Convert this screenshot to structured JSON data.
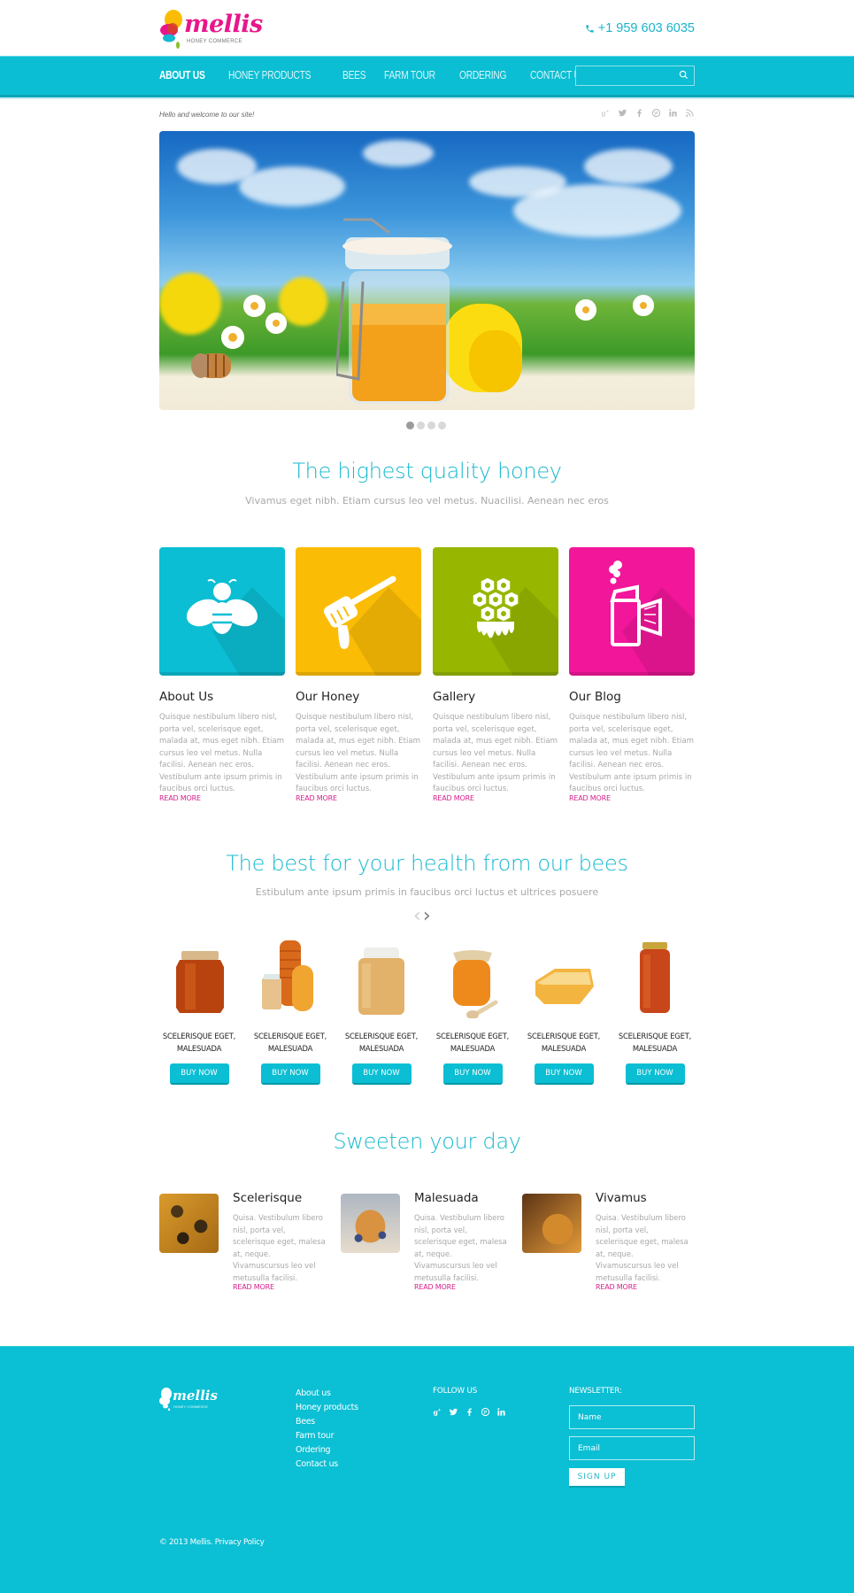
{
  "header": {
    "logo_text": "mellis",
    "logo_tagline": "HONEY COMMERCE",
    "phone": "+1 959 603 6035",
    "phone_icon": "phone-icon"
  },
  "nav": {
    "items": [
      {
        "label": "ABOUT US",
        "active": true
      },
      {
        "label": "HONEY PRODUCTS",
        "active": false
      },
      {
        "label": "BEES",
        "active": false
      },
      {
        "label": "FARM TOUR",
        "active": false
      },
      {
        "label": "ORDERING",
        "active": false
      },
      {
        "label": "CONTACT US",
        "active": false
      }
    ],
    "search": {
      "value": "",
      "placeholder": "",
      "icon": "search-icon"
    }
  },
  "topbar": {
    "welcome": "Hello and welcome to our site!",
    "social": [
      {
        "name": "google-plus-icon",
        "glyph": "g+"
      },
      {
        "name": "twitter-icon",
        "glyph": "t"
      },
      {
        "name": "facebook-icon",
        "glyph": "f"
      },
      {
        "name": "pinterest-icon",
        "glyph": "p"
      },
      {
        "name": "linkedin-icon",
        "glyph": "in"
      },
      {
        "name": "rss-icon",
        "glyph": "rss"
      }
    ]
  },
  "slider": {
    "image_alt": "Honey jar in a flower meadow",
    "slides_total": 4,
    "active_slide": 1
  },
  "section1": {
    "title": "The highest quality honey",
    "subtitle": "Vivamus eget nibh. Etiam cursus leo vel metus. Nuacilisi. Aenean nec eros"
  },
  "features": [
    {
      "title": "About Us",
      "icon": "bee-icon",
      "color": "#0bbed3",
      "text": "Quisque nestibulum libero nisl, porta vel, scelerisque eget, malada at, mus eget nibh. Etiam cursus leo vel metus. Nulla facilisi. Aenean nec eros. Vestibulum ante ipsum primis in faucibus orci luctus.",
      "link": "READ MORE"
    },
    {
      "title": "Our Honey",
      "icon": "honey-dipper-icon",
      "color": "#fbbc05",
      "text": "Quisque nestibulum libero nisl, porta vel, scelerisque eget, malada at, mus eget nibh. Etiam cursus leo vel metus. Nulla facilisi. Aenean nec eros. Vestibulum ante ipsum primis in faucibus orci luctus.",
      "link": "READ MORE"
    },
    {
      "title": "Gallery",
      "icon": "honeycomb-icon",
      "color": "#96b600",
      "text": "Quisque nestibulum libero nisl, porta vel, scelerisque eget, malada at, mus eget nibh. Etiam cursus leo vel metus. Nulla facilisi. Aenean nec eros. Vestibulum ante ipsum primis in faucibus orci luctus.",
      "link": "READ MORE"
    },
    {
      "title": "Our Blog",
      "icon": "bee-smoker-icon",
      "color": "#f2169a",
      "text": "Quisque nestibulum libero nisl, porta vel, scelerisque eget, malada at, mus eget nibh. Etiam cursus leo vel metus. Nulla facilisi. Aenean nec eros. Vestibulum ante ipsum primis in faucibus orci luctus.",
      "link": "READ MORE"
    }
  ],
  "section2": {
    "title": "The best for your health from our bees",
    "subtitle": "Estibulum ante ipsum primis in faucibus orci luctus et ultrices posuere",
    "prev_icon": "chevron-left-icon",
    "next_icon": "chevron-right-icon"
  },
  "products": [
    {
      "name_line1": "SCELERISQUE EGET,",
      "name_line2": "MALESUADA",
      "button": "BUY NOW",
      "image": "honey-jar-hexagonal"
    },
    {
      "name_line1": "SCELERISQUE EGET,",
      "name_line2": "MALESUADA",
      "button": "BUY NOW",
      "image": "honey-jars-group"
    },
    {
      "name_line1": "SCELERISQUE EGET,",
      "name_line2": "MALESUADA",
      "button": "BUY NOW",
      "image": "creamed-honey-jar"
    },
    {
      "name_line1": "SCELERISQUE EGET,",
      "name_line2": "MALESUADA",
      "button": "BUY NOW",
      "image": "honey-jar-with-dipper"
    },
    {
      "name_line1": "SCELERISQUE EGET,",
      "name_line2": "MALESUADA",
      "button": "BUY NOW",
      "image": "honeycomb-piece"
    },
    {
      "name_line1": "SCELERISQUE EGET,",
      "name_line2": "MALESUADA",
      "button": "BUY NOW",
      "image": "tall-honey-jar"
    }
  ],
  "section3": {
    "title": "Sweeten your day"
  },
  "blog": [
    {
      "title": "Scelerisque",
      "image": "bees-on-honeycomb",
      "text": "Quisa. Vestibulum libero nisl, porta vel, scelerisque eget, malesa at, neque. Vivamuscursus leo vel metusulla facilisi.",
      "link": "READ MORE"
    },
    {
      "title": "Malesuada",
      "image": "pancakes-with-honey",
      "text": "Quisa. Vestibulum libero nisl, porta vel, scelerisque eget, malesa at, neque. Vivamuscursus leo vel metusulla facilisi.",
      "link": "READ MORE"
    },
    {
      "title": "Vivamus",
      "image": "honey-dipper-pour",
      "text": "Quisa. Vestibulum libero nisl, porta vel, scelerisque eget, malesa at, neque. Vivamuscursus leo vel metusulla facilisi.",
      "link": "READ MORE"
    }
  ],
  "footer": {
    "logo_text": "mellis",
    "logo_tagline": "HONEY COMMERCE",
    "links": [
      "About us",
      "Honey products",
      "Bees",
      "Farm tour",
      "Ordering",
      "Contact us"
    ],
    "follow_title": "FOLLOW US",
    "follow_icons": [
      {
        "name": "google-plus-icon",
        "glyph": "g+"
      },
      {
        "name": "twitter-icon",
        "glyph": "t"
      },
      {
        "name": "facebook-icon",
        "glyph": "f"
      },
      {
        "name": "pinterest-icon",
        "glyph": "p"
      },
      {
        "name": "linkedin-icon",
        "glyph": "in"
      }
    ],
    "newsletter_title": "NEWSLETTER:",
    "name_placeholder": "Name",
    "email_placeholder": "Email",
    "signup_label": "SIGN UP",
    "copyright": "© 2013 Mellis. Privacy Policy"
  },
  "colors": {
    "brand_cyan": "#0bbed3",
    "brand_pink": "#e8168b",
    "link_magenta": "#d4208c",
    "heading_cyan": "#19b9ce"
  }
}
